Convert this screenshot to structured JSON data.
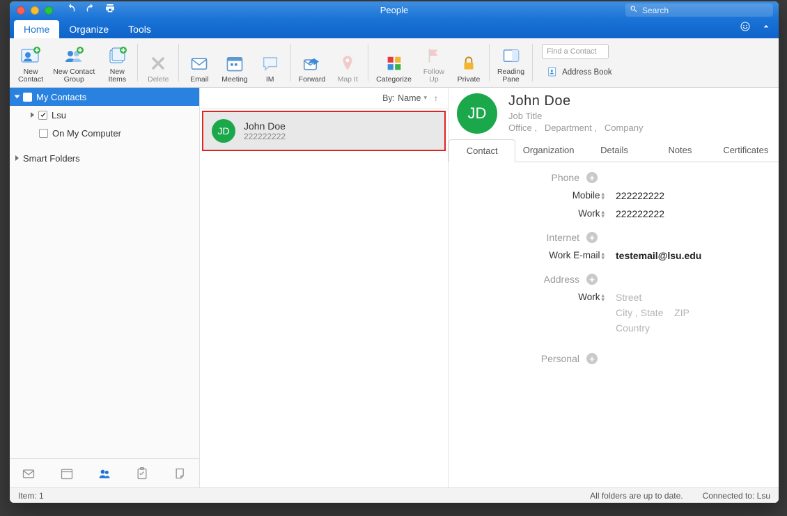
{
  "window": {
    "title": "People"
  },
  "search": {
    "placeholder": "Search"
  },
  "tabs": {
    "home": "Home",
    "organize": "Organize",
    "tools": "Tools"
  },
  "ribbon": {
    "new_contact": "New\nContact",
    "new_contact_group": "New Contact\nGroup",
    "new_items": "New\nItems",
    "delete": "Delete",
    "email": "Email",
    "meeting": "Meeting",
    "im": "IM",
    "forward": "Forward",
    "map_it": "Map It",
    "categorize": "Categorize",
    "follow_up": "Follow\nUp",
    "private": "Private",
    "reading_pane": "Reading\nPane",
    "find_placeholder": "Find a Contact",
    "address_book": "Address Book"
  },
  "sidebar": {
    "my_contacts": "My Contacts",
    "lsu": "Lsu",
    "on_my_computer": "On My Computer",
    "smart_folders": "Smart Folders"
  },
  "list": {
    "sort_prefix": "By:",
    "sort_value": "Name",
    "row": {
      "name": "John Doe",
      "sub": "222222222",
      "initials": "JD"
    }
  },
  "detail": {
    "initials": "JD",
    "name": "John  Doe",
    "job": "Job Title",
    "office": "Office",
    "department": "Department",
    "company": "Company",
    "tabs": {
      "contact": "Contact",
      "organization": "Organization",
      "details": "Details",
      "notes": "Notes",
      "certificates": "Certificates"
    },
    "sections": {
      "phone": {
        "label": "Phone",
        "mobile_label": "Mobile",
        "mobile_value": "222222222",
        "work_label": "Work",
        "work_value": "222222222"
      },
      "internet": {
        "label": "Internet",
        "work_email_label": "Work E-mail",
        "work_email_value": "testemail@lsu.edu"
      },
      "address": {
        "label": "Address",
        "work_label": "Work",
        "street": "Street",
        "city": "City",
        "state": "State",
        "zip": "ZIP",
        "country": "Country"
      },
      "personal": {
        "label": "Personal"
      }
    }
  },
  "status": {
    "item_count": "Item: 1",
    "folders": "All folders are up to date.",
    "connected": "Connected to: Lsu"
  }
}
